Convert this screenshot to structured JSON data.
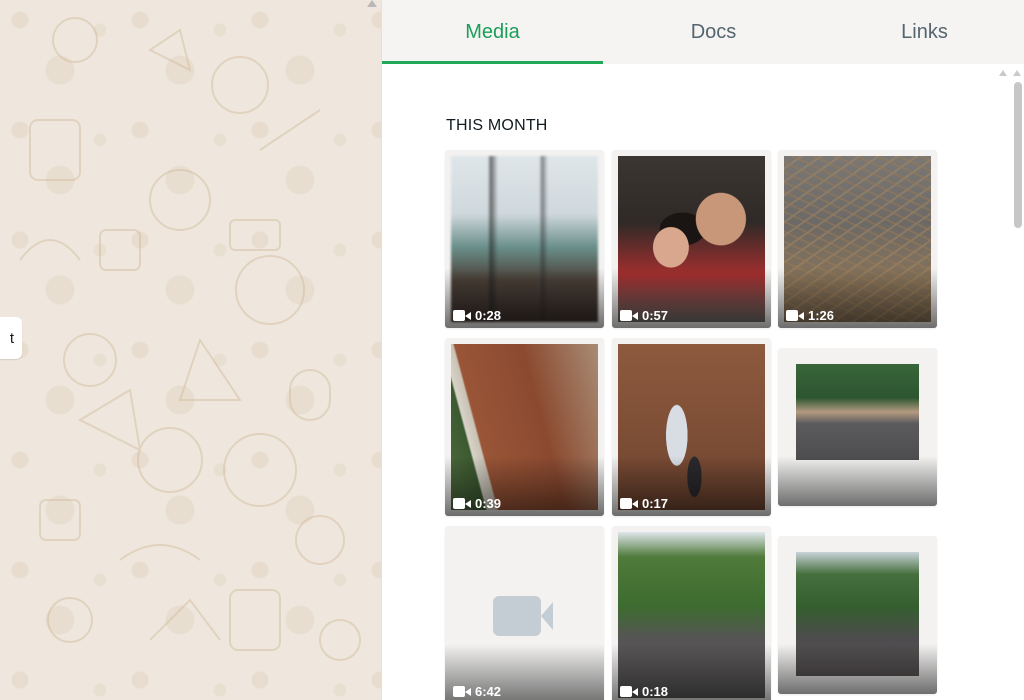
{
  "chat": {
    "bubble_text": "t"
  },
  "tabs": [
    {
      "label": "Media",
      "active": true
    },
    {
      "label": "Docs",
      "active": false
    },
    {
      "label": "Links",
      "active": false
    }
  ],
  "media": {
    "section_title": "THIS MONTH",
    "items": [
      {
        "type": "video",
        "duration": "0:28"
      },
      {
        "type": "video",
        "duration": "0:57"
      },
      {
        "type": "video",
        "duration": "1:26"
      },
      {
        "type": "video",
        "duration": "0:39"
      },
      {
        "type": "video",
        "duration": "0:17"
      },
      {
        "type": "image",
        "duration": ""
      },
      {
        "type": "video",
        "duration": "6:42"
      },
      {
        "type": "video",
        "duration": "0:18"
      },
      {
        "type": "image",
        "duration": ""
      }
    ]
  },
  "colors": {
    "accent": "#1fa855",
    "tab_text": "#54656f",
    "wallpaper": "#efe7dd"
  }
}
